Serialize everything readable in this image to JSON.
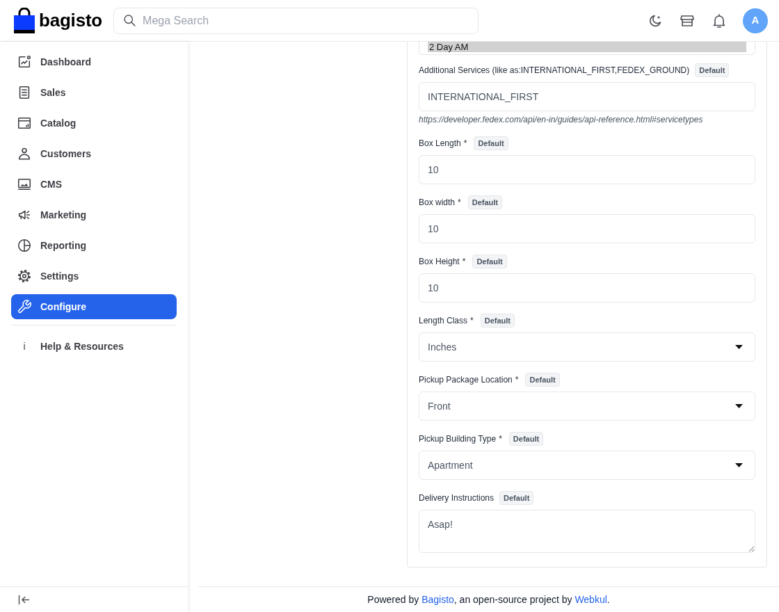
{
  "header": {
    "logo_text": "bagisto",
    "search": {
      "placeholder": "Mega Search"
    },
    "avatar": {
      "initial": "A"
    }
  },
  "sidebar": {
    "items": [
      {
        "label": "Dashboard",
        "selected": false
      },
      {
        "label": "Sales",
        "selected": false
      },
      {
        "label": "Catalog",
        "selected": false
      },
      {
        "label": "Customers",
        "selected": false
      },
      {
        "label": "CMS",
        "selected": false
      },
      {
        "label": "Marketing",
        "selected": false
      },
      {
        "label": "Reporting",
        "selected": false
      },
      {
        "label": "Settings",
        "selected": false
      },
      {
        "label": "Configure",
        "selected": true
      }
    ],
    "help": {
      "icon": "i",
      "label": "Help & Resources"
    }
  },
  "form": {
    "clipped_select": {
      "options": [
        {
          "label": "2 Day AM",
          "selected": true
        }
      ]
    },
    "fields": [
      {
        "kind": "text",
        "label": "Additional Services (like as:INTERNATIONAL_FIRST,FEDEX_GROUND)",
        "badge": "Default",
        "value": "INTERNATIONAL_FIRST",
        "help": "https://developer.fedex.com/api/en-in/guides/api-reference.html#servicetypes"
      },
      {
        "kind": "text",
        "label": "Box Length",
        "required_mark": "*",
        "badge": "Default",
        "value": "10"
      },
      {
        "kind": "text",
        "label": "Box width",
        "required_mark": "*",
        "badge": "Default",
        "value": "10"
      },
      {
        "kind": "text",
        "label": "Box Height",
        "required_mark": "*",
        "badge": "Default",
        "value": "10"
      },
      {
        "kind": "select",
        "label": "Length Class",
        "required_mark": "*",
        "badge": "Default",
        "value": "Inches"
      },
      {
        "kind": "select",
        "label": "Pickup Package Location",
        "required_mark": "*",
        "badge": "Default",
        "value": "Front"
      },
      {
        "kind": "select",
        "label": "Pickup Building Type",
        "required_mark": "*",
        "badge": "Default",
        "value": "Apartment"
      },
      {
        "kind": "textarea",
        "label": "Delivery Instructions",
        "badge": "Default",
        "value": "Asap!"
      }
    ]
  },
  "footer": {
    "parts": [
      {
        "kind": "text",
        "text": "Powered by "
      },
      {
        "kind": "link",
        "text": "Bagisto"
      },
      {
        "kind": "text",
        "text": ", an open-source project by "
      },
      {
        "kind": "link",
        "text": "Webkul"
      },
      {
        "kind": "text",
        "text": "."
      }
    ]
  }
}
